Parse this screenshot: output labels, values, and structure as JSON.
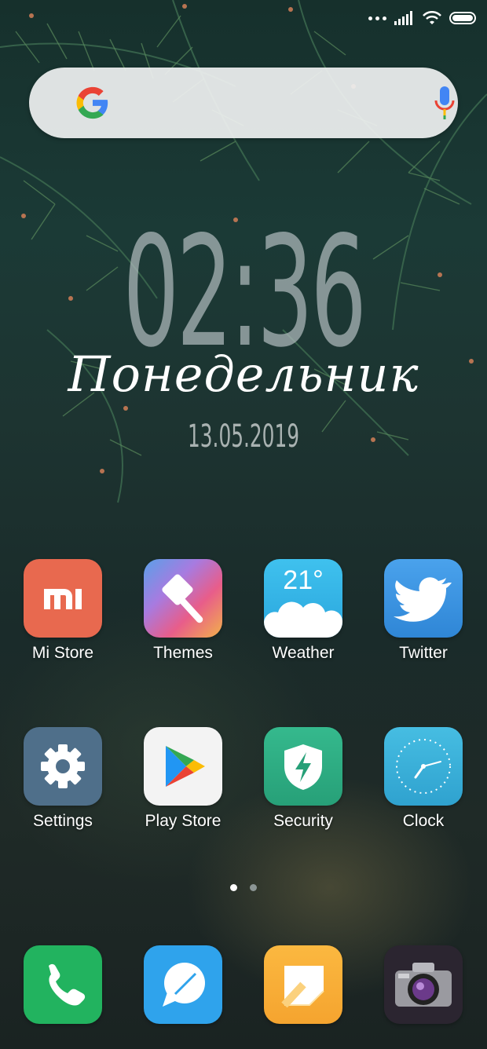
{
  "clock": {
    "time": "02:36",
    "day": "Понедельник",
    "date": "13.05.2019"
  },
  "weather": {
    "temperature": "21°"
  },
  "apps": [
    {
      "label": "Mi Store",
      "color": "#e8694f",
      "icon": "mi-logo-icon"
    },
    {
      "label": "Themes",
      "color": "#e85d8a",
      "icon": "paintbrush-icon"
    },
    {
      "label": "Weather",
      "color": "#36b6e8",
      "icon": "cloud-icon"
    },
    {
      "label": "Twitter",
      "color": "#3d93e2",
      "icon": "twitter-bird-icon"
    },
    {
      "label": "Settings",
      "color": "#4f6f8a",
      "icon": "gear-icon"
    },
    {
      "label": "Play Store",
      "color": "#f3f3f3",
      "icon": "play-store-icon"
    },
    {
      "label": "Security",
      "color": "#2fae84",
      "icon": "shield-bolt-icon"
    },
    {
      "label": "Clock",
      "color": "#3fb3d8",
      "icon": "clock-icon"
    }
  ],
  "dock": [
    {
      "name": "phone",
      "color": "#22b35f",
      "icon": "phone-icon"
    },
    {
      "name": "messages",
      "color": "#2fa3ec",
      "icon": "chat-bubble-icon"
    },
    {
      "name": "notes",
      "color": "#f8b03a",
      "icon": "note-icon"
    },
    {
      "name": "camera",
      "color": "#2b2530",
      "icon": "camera-icon"
    }
  ],
  "pager": {
    "pages": 2,
    "active": 1
  },
  "colors": {
    "text": "#ffffff",
    "pager_active": "#ffffff",
    "pager_inactive": "#8b9594"
  }
}
